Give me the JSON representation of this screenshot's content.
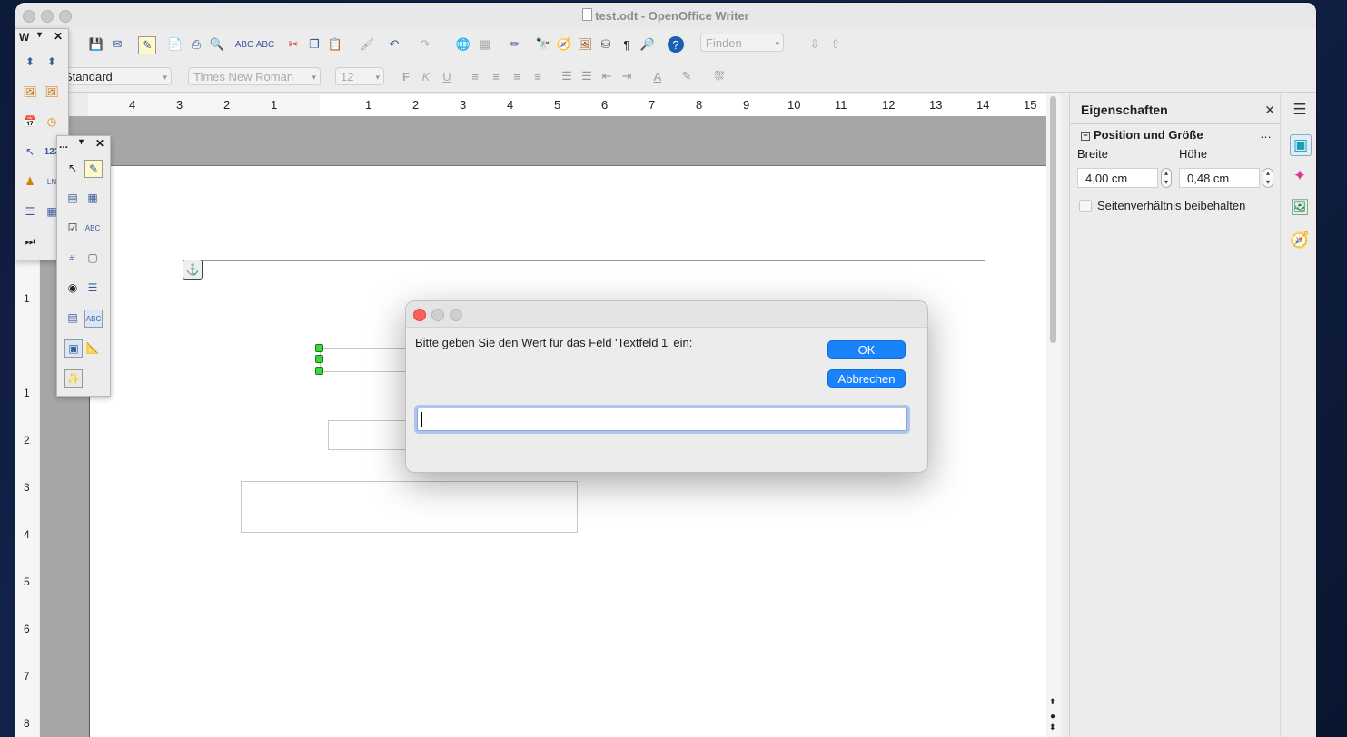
{
  "window": {
    "title": "test.odt - OpenOffice Writer"
  },
  "toolbar": {
    "find_placeholder": "Finden",
    "paragraph_style": "Standard",
    "font_name": "Times New Roman",
    "font_size": "12"
  },
  "ruler": {
    "horizontal": [
      "4",
      "3",
      "2",
      "1",
      "1",
      "2",
      "3",
      "4",
      "5",
      "6",
      "7",
      "8",
      "9",
      "10",
      "11",
      "12",
      "13",
      "14",
      "15"
    ],
    "vertical": [
      "1",
      "1",
      "2",
      "3",
      "4",
      "5",
      "6",
      "7",
      "8"
    ]
  },
  "sidebar": {
    "title": "Eigenschaften",
    "section": "Position und Größe",
    "width_label": "Breite",
    "height_label": "Höhe",
    "width_value": "4,00 cm",
    "height_value": "0,48 cm",
    "keep_ratio_label": "Seitenverhältnis beibehalten"
  },
  "float_toolbar_1": {
    "title": "W"
  },
  "float_toolbar_2": {
    "title": "..."
  },
  "dialog": {
    "prompt": "Bitte geben Sie den Wert für das Feld 'Textfeld 1' ein:",
    "ok_label": "OK",
    "cancel_label": "Abbrechen",
    "input_value": ""
  },
  "icons": {
    "float1": [
      "scroll-icon",
      "scroll-icon",
      "image-icon",
      "image-icon",
      "calendar-icon",
      "clock-icon",
      "cursor-icon",
      "number-icon",
      "people-icon",
      "line-icon",
      "list-icon",
      "table-icon",
      "media-icon"
    ],
    "float2": [
      "select-icon",
      "design-icon",
      "group-icon",
      "table-icon",
      "checkbox-icon",
      "textbox-icon",
      "field-icon",
      "button-icon",
      "radio-icon",
      "list-icon",
      "combo-icon",
      "label-icon",
      "nav-icon",
      "form-icon",
      "wizard-icon"
    ]
  },
  "colors": {
    "accent": "#1a82fb",
    "close_red": "#ff5f57"
  }
}
